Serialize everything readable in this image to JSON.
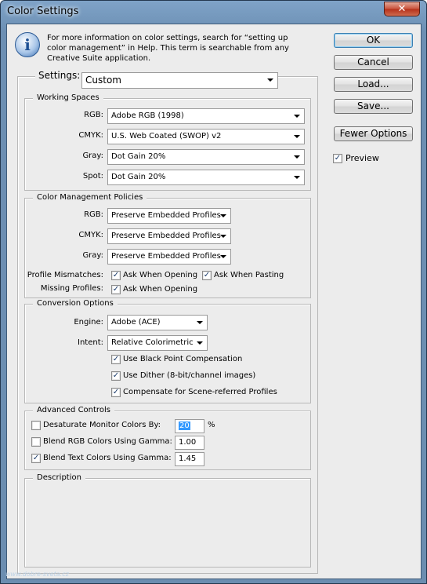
{
  "window": {
    "title": "Color Settings",
    "close_glyph": "✕"
  },
  "info": {
    "icon_glyph": "i",
    "text": "For more information on color settings, search for “setting up color management” in Help. This term is searchable from any Creative Suite application."
  },
  "buttons": {
    "ok": "OK",
    "cancel": "Cancel",
    "load": "Load...",
    "save": "Save...",
    "fewer_options": "Fewer Options"
  },
  "preview": {
    "label": "Preview",
    "checked": true
  },
  "settings": {
    "label": "Settings:",
    "value": "Custom"
  },
  "working_spaces": {
    "title": "Working Spaces",
    "rgb": {
      "label": "RGB:",
      "value": "Adobe RGB (1998)"
    },
    "cmyk": {
      "label": "CMYK:",
      "value": "U.S. Web Coated (SWOP) v2"
    },
    "gray": {
      "label": "Gray:",
      "value": "Dot Gain 20%"
    },
    "spot": {
      "label": "Spot:",
      "value": "Dot Gain 20%"
    }
  },
  "policies": {
    "title": "Color Management Policies",
    "rgb": {
      "label": "RGB:",
      "value": "Preserve Embedded Profiles"
    },
    "cmyk": {
      "label": "CMYK:",
      "value": "Preserve Embedded Profiles"
    },
    "gray": {
      "label": "Gray:",
      "value": "Preserve Embedded Profiles"
    },
    "profile_mismatches_label": "Profile Mismatches:",
    "ask_when_opening": "Ask When Opening",
    "ask_when_pasting": "Ask When Pasting",
    "missing_profiles_label": "Missing Profiles:",
    "missing_ask_when_opening": "Ask When Opening"
  },
  "conversion": {
    "title": "Conversion Options",
    "engine": {
      "label": "Engine:",
      "value": "Adobe (ACE)"
    },
    "intent": {
      "label": "Intent:",
      "value": "Relative Colorimetric"
    },
    "black_point": "Use Black Point Compensation",
    "dither": "Use Dither (8-bit/channel images)",
    "scene_referred": "Compensate for Scene-referred Profiles"
  },
  "advanced": {
    "title": "Advanced Controls",
    "desaturate": {
      "label": "Desaturate Monitor Colors By:",
      "value": "20",
      "unit": "%",
      "checked": false
    },
    "blend_rgb": {
      "label": "Blend RGB Colors Using Gamma:",
      "value": "1.00",
      "checked": false
    },
    "blend_text": {
      "label": "Blend Text Colors Using Gamma:",
      "value": "1.45",
      "checked": true
    }
  },
  "description": {
    "title": "Description"
  },
  "watermark": "www.dobre-sveta.cz",
  "checkmark": "✓"
}
